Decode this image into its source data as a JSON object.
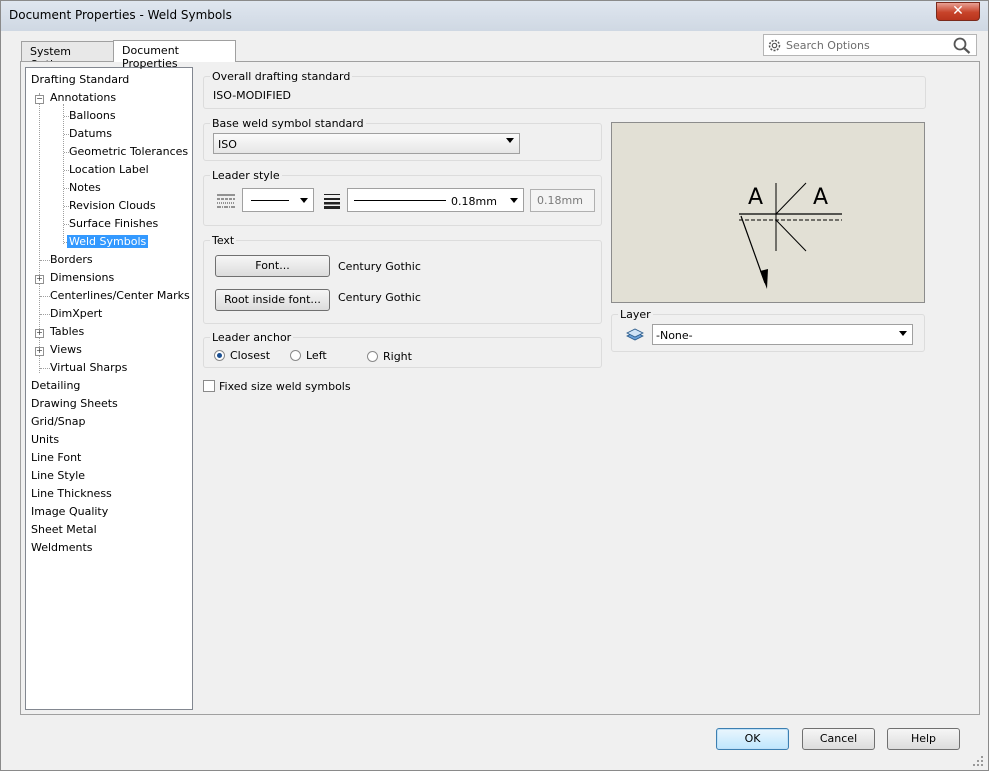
{
  "window": {
    "title": "Document Properties - Weld Symbols",
    "close_glyph": "✕"
  },
  "tabs": [
    {
      "label": "System Options",
      "active": false
    },
    {
      "label": "Document Properties",
      "active": true
    }
  ],
  "search": {
    "placeholder": "Search Options"
  },
  "tree": {
    "items": [
      {
        "label": "Drafting Standard",
        "level": 0
      },
      {
        "label": "Annotations",
        "level": 1,
        "expander": "minus"
      },
      {
        "label": "Balloons",
        "level": 2
      },
      {
        "label": "Datums",
        "level": 2
      },
      {
        "label": "Geometric Tolerances",
        "level": 2
      },
      {
        "label": "Location Label",
        "level": 2
      },
      {
        "label": "Notes",
        "level": 2
      },
      {
        "label": "Revision Clouds",
        "level": 2
      },
      {
        "label": "Surface Finishes",
        "level": 2
      },
      {
        "label": "Weld Symbols",
        "level": 2,
        "selected": true
      },
      {
        "label": "Borders",
        "level": 1
      },
      {
        "label": "Dimensions",
        "level": 1,
        "expander": "plus"
      },
      {
        "label": "Centerlines/Center Marks",
        "level": 1
      },
      {
        "label": "DimXpert",
        "level": 1
      },
      {
        "label": "Tables",
        "level": 1,
        "expander": "plus"
      },
      {
        "label": "Views",
        "level": 1,
        "expander": "plus"
      },
      {
        "label": "Virtual Sharps",
        "level": 1
      },
      {
        "label": "Detailing",
        "level": 0
      },
      {
        "label": "Drawing Sheets",
        "level": 0
      },
      {
        "label": "Grid/Snap",
        "level": 0
      },
      {
        "label": "Units",
        "level": 0
      },
      {
        "label": "Line Font",
        "level": 0
      },
      {
        "label": "Line Style",
        "level": 0
      },
      {
        "label": "Line Thickness",
        "level": 0
      },
      {
        "label": "Image Quality",
        "level": 0
      },
      {
        "label": "Sheet Metal",
        "level": 0
      },
      {
        "label": "Weldments",
        "level": 0
      }
    ]
  },
  "overall_standard": {
    "label": "Overall drafting standard",
    "value": "ISO-MODIFIED"
  },
  "base_weld": {
    "label": "Base weld symbol standard",
    "value": "ISO"
  },
  "leader_style": {
    "label": "Leader style",
    "thickness_value": "0.18mm",
    "custom_value": "0.18mm"
  },
  "text_group": {
    "label": "Text",
    "font_button": "Font...",
    "font_name": "Century Gothic",
    "root_button": "Root inside font...",
    "root_font_name": "Century Gothic"
  },
  "leader_anchor": {
    "label": "Leader anchor",
    "options": [
      {
        "label": "Closest",
        "selected": true
      },
      {
        "label": "Left",
        "selected": false
      },
      {
        "label": "Right",
        "selected": false
      }
    ]
  },
  "fixed_size": {
    "label": "Fixed size weld symbols",
    "checked": false
  },
  "preview": {
    "left_text": "A",
    "right_text": "A"
  },
  "layer": {
    "label": "Layer",
    "value": "-None-"
  },
  "buttons": {
    "ok": "OK",
    "cancel": "Cancel",
    "help": "Help"
  },
  "colors": {
    "selection": "#3399ff",
    "preview_bg": "#e2e0d5",
    "close_red": "#c7432a"
  }
}
